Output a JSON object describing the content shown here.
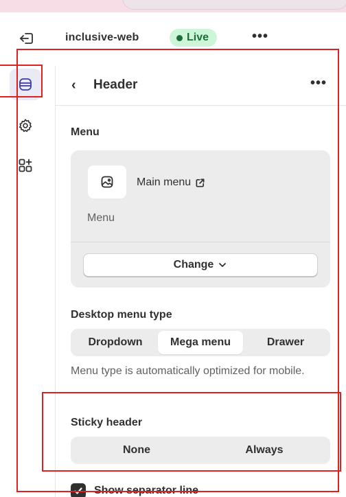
{
  "topbar": {
    "store_name": "inclusive-web",
    "live_label": "Live",
    "more": "•••"
  },
  "rail": {
    "items": [
      {
        "icon": "sections-icon",
        "active": true
      },
      {
        "icon": "settings-gear-icon",
        "active": false
      },
      {
        "icon": "add-apps-icon",
        "active": false
      }
    ]
  },
  "panel": {
    "back": "‹",
    "title": "Header",
    "more": "•••",
    "menu": {
      "label": "Menu",
      "link_text": "Main menu",
      "sub_text": "Menu",
      "change_label": "Change"
    },
    "desktop_menu_type": {
      "label": "Desktop menu type",
      "options": [
        "Dropdown",
        "Mega menu",
        "Drawer"
      ],
      "selected": "Mega menu",
      "helper": "Menu type is automatically optimized for mobile."
    },
    "sticky_header": {
      "label": "Sticky header",
      "options": [
        "None",
        "Always"
      ]
    },
    "separator": {
      "label": "Show separator line",
      "checked": true
    }
  },
  "colors": {
    "live_badge_bg": "#cdf5d8",
    "live_badge_text": "#1f6b3a",
    "highlight": "#e02020",
    "active_rail_bg": "#e9eaf3"
  }
}
